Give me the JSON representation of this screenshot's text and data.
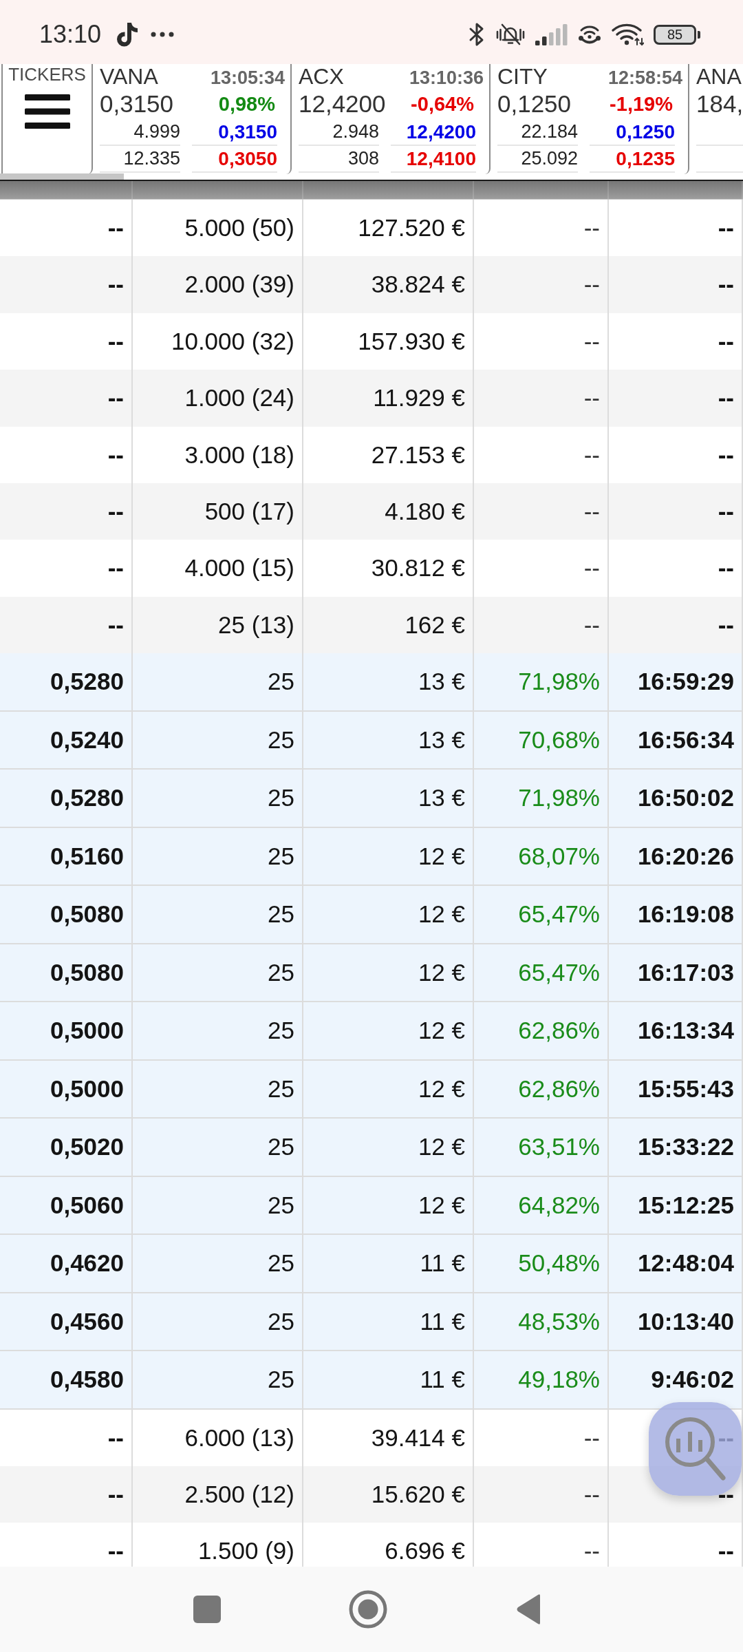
{
  "status_bar": {
    "time": "13:10",
    "battery": "85"
  },
  "tickers": {
    "label": "TICKERS",
    "items": [
      {
        "symbol": "VANA",
        "time": "13:05:34",
        "price": "0,3150",
        "change": "0,98%",
        "rising": true,
        "lines": [
          {
            "volume": "4.999",
            "quote": "0,3150",
            "color": "#0000e6"
          },
          {
            "volume": "12.335",
            "quote": "0,3050",
            "color": "#e60000"
          }
        ]
      },
      {
        "symbol": "ACX",
        "time": "13:10:36",
        "price": "12,4200",
        "change": "-0,64%",
        "rising": false,
        "lines": [
          {
            "volume": "2.948",
            "quote": "12,4200",
            "color": "#0000e6"
          },
          {
            "volume": "308",
            "quote": "12,4100",
            "color": "#e60000"
          }
        ]
      },
      {
        "symbol": "CITY",
        "time": "12:58:54",
        "price": "0,1250",
        "change": "-1,19%",
        "rising": false,
        "lines": [
          {
            "volume": "22.184",
            "quote": "0,1250",
            "color": "#0000e6"
          },
          {
            "volume": "25.092",
            "quote": "0,1235",
            "color": "#e60000"
          }
        ]
      },
      {
        "symbol": "ANA",
        "price": "184,"
      }
    ]
  },
  "table": {
    "rows": [
      {
        "kind": "group",
        "cells": [
          "--",
          "5.000 (50)",
          "127.520 €",
          "--",
          "--"
        ]
      },
      {
        "kind": "group",
        "cells": [
          "--",
          "2.000 (39)",
          "38.824 €",
          "--",
          "--"
        ]
      },
      {
        "kind": "group",
        "cells": [
          "--",
          "10.000 (32)",
          "157.930 €",
          "--",
          "--"
        ]
      },
      {
        "kind": "group",
        "cells": [
          "--",
          "1.000 (24)",
          "11.929 €",
          "--",
          "--"
        ]
      },
      {
        "kind": "group",
        "cells": [
          "--",
          "3.000 (18)",
          "27.153 €",
          "--",
          "--"
        ]
      },
      {
        "kind": "group",
        "cells": [
          "--",
          "500 (17)",
          "4.180 €",
          "--",
          "--"
        ]
      },
      {
        "kind": "group",
        "cells": [
          "--",
          "4.000 (15)",
          "30.812 €",
          "--",
          "--"
        ]
      },
      {
        "kind": "group",
        "cells": [
          "--",
          "25 (13)",
          "162 €",
          "--",
          "--"
        ]
      },
      {
        "kind": "trade",
        "cells": [
          "0,5280",
          "25",
          "13 €",
          "71,98%",
          "16:59:29"
        ]
      },
      {
        "kind": "trade",
        "cells": [
          "0,5240",
          "25",
          "13 €",
          "70,68%",
          "16:56:34"
        ]
      },
      {
        "kind": "trade",
        "cells": [
          "0,5280",
          "25",
          "13 €",
          "71,98%",
          "16:50:02"
        ]
      },
      {
        "kind": "trade",
        "cells": [
          "0,5160",
          "25",
          "12 €",
          "68,07%",
          "16:20:26"
        ]
      },
      {
        "kind": "trade",
        "cells": [
          "0,5080",
          "25",
          "12 €",
          "65,47%",
          "16:19:08"
        ]
      },
      {
        "kind": "trade",
        "cells": [
          "0,5080",
          "25",
          "12 €",
          "65,47%",
          "16:17:03"
        ]
      },
      {
        "kind": "trade",
        "cells": [
          "0,5000",
          "25",
          "12 €",
          "62,86%",
          "16:13:34"
        ]
      },
      {
        "kind": "trade",
        "cells": [
          "0,5000",
          "25",
          "12 €",
          "62,86%",
          "15:55:43"
        ]
      },
      {
        "kind": "trade",
        "cells": [
          "0,5020",
          "25",
          "12 €",
          "63,51%",
          "15:33:22"
        ]
      },
      {
        "kind": "trade",
        "cells": [
          "0,5060",
          "25",
          "12 €",
          "64,82%",
          "15:12:25"
        ]
      },
      {
        "kind": "trade",
        "cells": [
          "0,4620",
          "25",
          "11 €",
          "50,48%",
          "12:48:04"
        ]
      },
      {
        "kind": "trade",
        "cells": [
          "0,4560",
          "25",
          "11 €",
          "48,53%",
          "10:13:40"
        ]
      },
      {
        "kind": "trade",
        "cells": [
          "0,4580",
          "25",
          "11 €",
          "49,18%",
          "9:46:02"
        ]
      },
      {
        "kind": "group",
        "cells": [
          "--",
          "6.000 (13)",
          "39.414 €",
          "--",
          "--"
        ]
      },
      {
        "kind": "group",
        "cells": [
          "--",
          "2.500 (12)",
          "15.620 €",
          "--",
          "--"
        ]
      },
      {
        "kind": "group",
        "cells": [
          "--",
          "1.500 (9)",
          "6.696 €",
          "--",
          "--"
        ]
      }
    ]
  }
}
